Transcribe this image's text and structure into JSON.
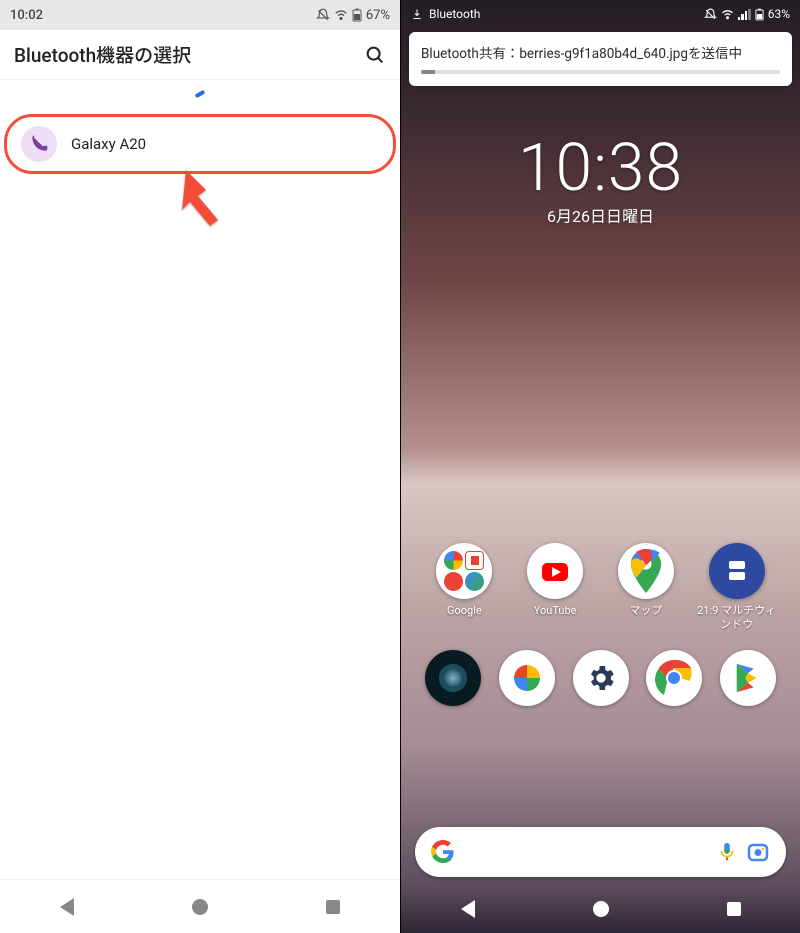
{
  "left": {
    "status": {
      "time": "10:02",
      "battery": "67%"
    },
    "header": {
      "title": "Bluetooth機器の選択"
    },
    "devices": [
      {
        "name": "Galaxy A20",
        "icon": "phone-icon"
      }
    ]
  },
  "right": {
    "status": {
      "label": "Bluetooth",
      "battery": "63%"
    },
    "notification": {
      "text": "Bluetooth共有：berries-g9f1a80b4d_640.jpgを送信中"
    },
    "clock": {
      "time": "10:38",
      "date": "6月26日日曜日"
    },
    "apps_row1": [
      {
        "label": "Google",
        "icon": "google-folder-icon"
      },
      {
        "label": "YouTube",
        "icon": "youtube-icon"
      },
      {
        "label": "マップ",
        "icon": "maps-icon"
      },
      {
        "label": "21:9 マルチウィンドウ",
        "icon": "multiwindow-icon"
      }
    ],
    "apps_row2": [
      {
        "label": "",
        "icon": "camera-lens-icon"
      },
      {
        "label": "",
        "icon": "photos-icon"
      },
      {
        "label": "",
        "icon": "settings-icon"
      },
      {
        "label": "",
        "icon": "chrome-icon"
      },
      {
        "label": "",
        "icon": "play-store-icon"
      }
    ]
  }
}
